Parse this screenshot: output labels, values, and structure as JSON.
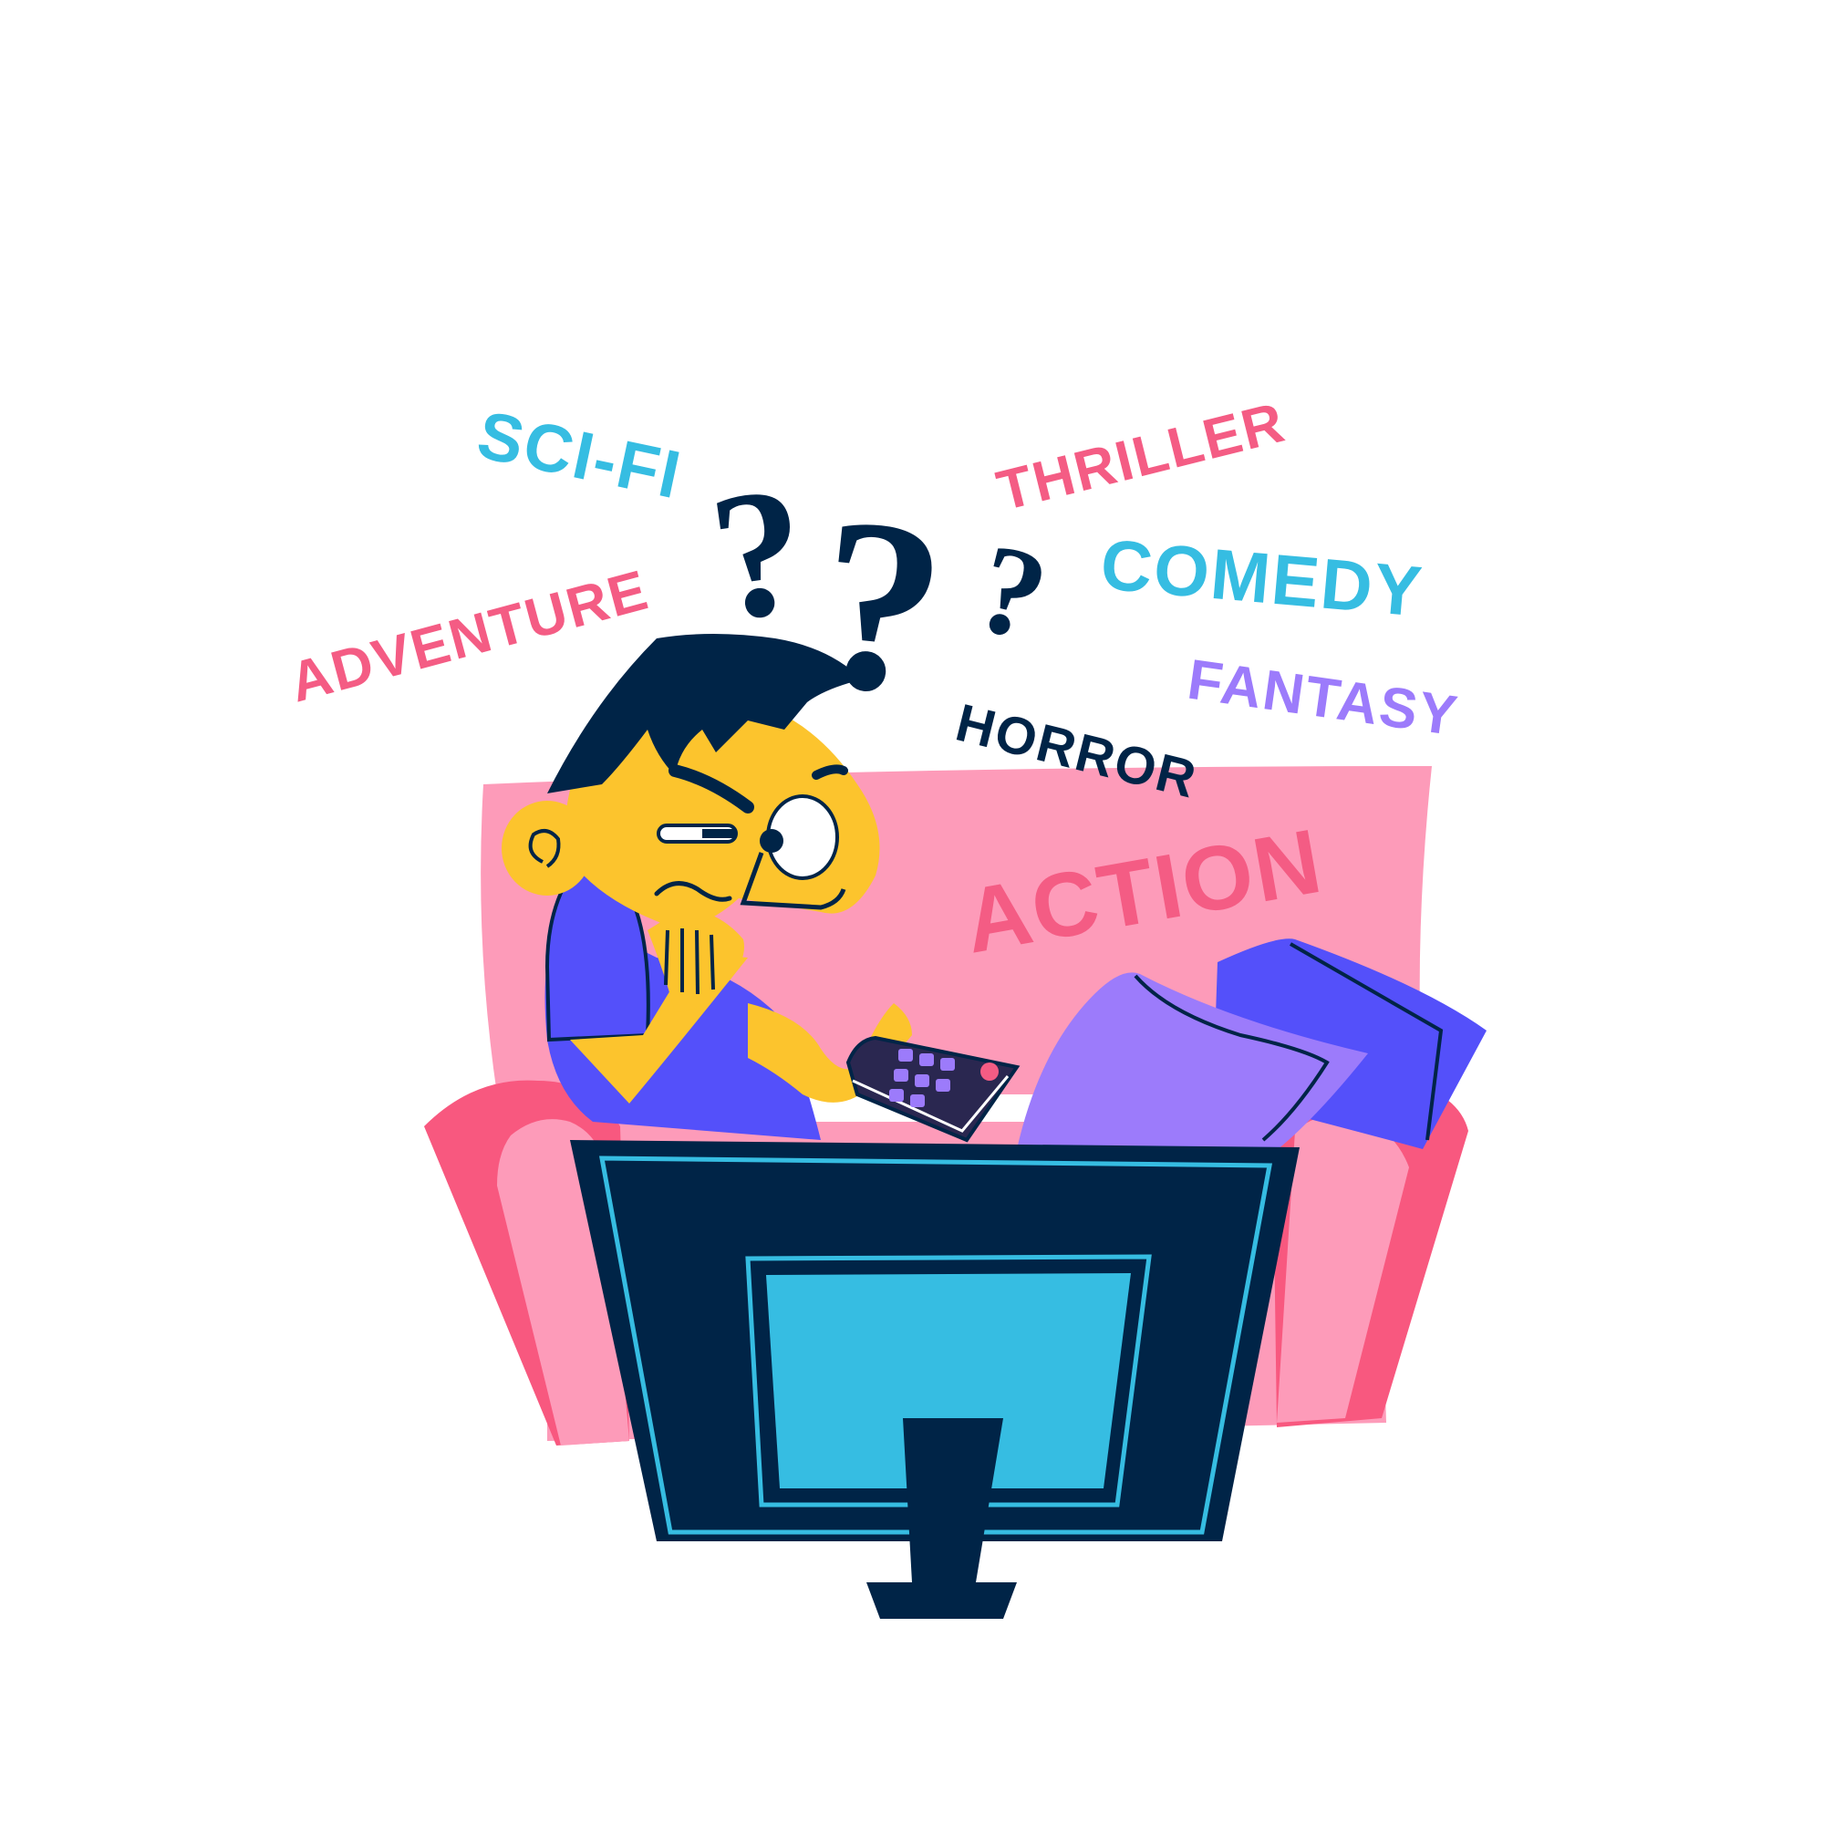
{
  "genres": {
    "scifi": "SCI-FI",
    "thriller": "THRILLER",
    "comedy": "COMEDY",
    "adventure": "ADVENTURE",
    "fantasy": "FANTASY",
    "horror": "HORROR",
    "action": "ACTION"
  },
  "question_marks": [
    "?",
    "?",
    "?"
  ],
  "colors": {
    "background": "#ffffff",
    "navy": "#002447",
    "cyan": "#36bde2",
    "pink": "#f45c84",
    "light_pink": "#fd9bb9",
    "sofa_dark_pink": "#f8587f",
    "purple": "#9c7bfb",
    "blue_violet": "#5450fa",
    "skin_yellow": "#fcc42d",
    "remote_dark": "#2a2750"
  }
}
